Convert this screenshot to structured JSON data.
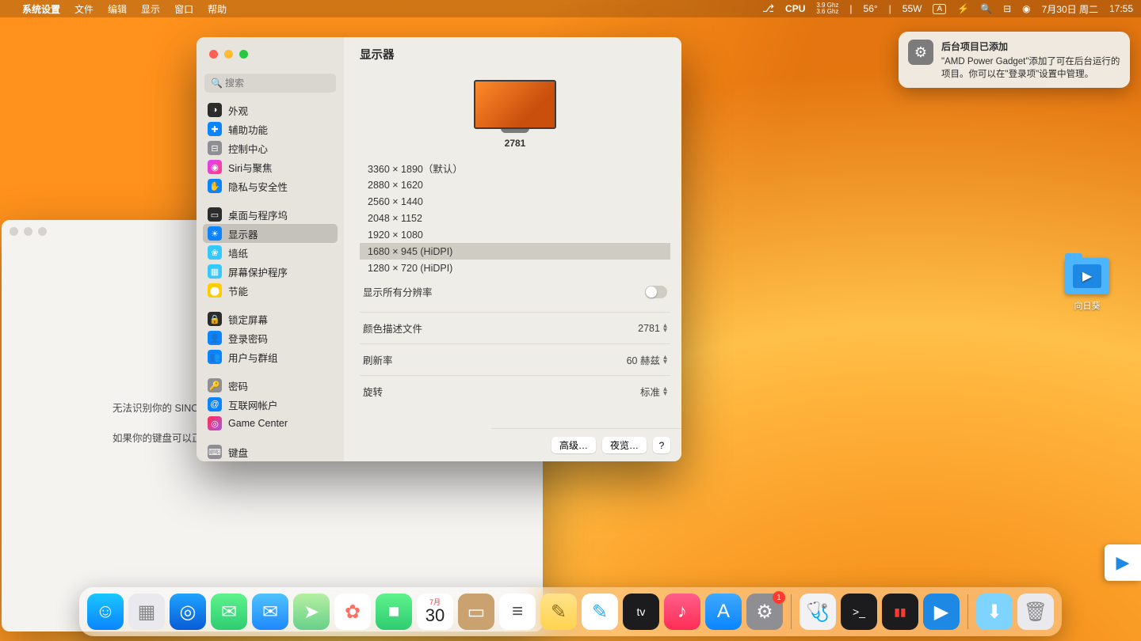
{
  "menubar": {
    "app": "系统设置",
    "items": [
      "文件",
      "编辑",
      "显示",
      "窗口",
      "帮助"
    ],
    "cpu_label": "CPU",
    "cpu_freq1": "3.9 Ghz",
    "cpu_freq2": "3.6 Ghz",
    "temp": "56°",
    "power": "55W",
    "input_indicator": "A",
    "date": "7月30日 周二",
    "time": "17:55"
  },
  "bgwin": {
    "line1": "无法识别你的 SINO",
    "line2": "如果你的键盘可以正常使用，则可以退出此助手。"
  },
  "win": {
    "title": "显示器",
    "search_placeholder": "搜索",
    "monitor_name": "2781",
    "resolutions": [
      {
        "label": "3360 × 1890（默认）",
        "sel": false
      },
      {
        "label": "2880 × 1620",
        "sel": false
      },
      {
        "label": "2560 × 1440",
        "sel": false
      },
      {
        "label": "2048 × 1152",
        "sel": false
      },
      {
        "label": "1920 × 1080",
        "sel": false
      },
      {
        "label": "1680 × 945 (HiDPI)",
        "sel": true
      },
      {
        "label": "1280 × 720 (HiDPI)",
        "sel": false
      }
    ],
    "show_all_label": "显示所有分辨率",
    "rows": {
      "color_profile_label": "颜色描述文件",
      "color_profile_value": "2781",
      "refresh_label": "刷新率",
      "refresh_value": "60 赫兹",
      "rotation_label": "旋转",
      "rotation_value": "标准"
    },
    "buttons": {
      "advanced": "高级…",
      "night": "夜览…",
      "help": "?"
    }
  },
  "sidebar": [
    {
      "label": "外观",
      "ic": "◑",
      "bg": "#2c2c2c"
    },
    {
      "label": "辅助功能",
      "ic": "✚",
      "bg": "#0a84ff"
    },
    {
      "label": "控制中心",
      "ic": "⊟",
      "bg": "#8e8e93"
    },
    {
      "label": "Siri与聚焦",
      "ic": "◉",
      "bg": "linear-gradient(135deg,#e040fb,#ff4081)"
    },
    {
      "label": "隐私与安全性",
      "ic": "✋",
      "bg": "#0a84ff"
    },
    {
      "gap": true
    },
    {
      "label": "桌面与程序坞",
      "ic": "▭",
      "bg": "#2c2c2c"
    },
    {
      "label": "显示器",
      "ic": "☀",
      "bg": "#0a84ff",
      "sel": true
    },
    {
      "label": "墙纸",
      "ic": "❀",
      "bg": "#34c8ff"
    },
    {
      "label": "屏幕保护程序",
      "ic": "▦",
      "bg": "#34c8ff"
    },
    {
      "label": "节能",
      "ic": "⬤",
      "bg": "#ffcc00"
    },
    {
      "gap": true
    },
    {
      "label": "锁定屏幕",
      "ic": "🔒",
      "bg": "#2c2c2c"
    },
    {
      "label": "登录密码",
      "ic": "👤",
      "bg": "#0a84ff"
    },
    {
      "label": "用户与群组",
      "ic": "👥",
      "bg": "#0a84ff"
    },
    {
      "gap": true
    },
    {
      "label": "密码",
      "ic": "🔑",
      "bg": "#8e8e93"
    },
    {
      "label": "互联网帐户",
      "ic": "@",
      "bg": "#0a84ff"
    },
    {
      "label": "Game Center",
      "ic": "◎",
      "bg": "linear-gradient(135deg,#ff2d55,#af52de)"
    },
    {
      "gap": true
    },
    {
      "label": "键盘",
      "ic": "⌨",
      "bg": "#8e8e93"
    }
  ],
  "notif": {
    "title": "后台项目已添加",
    "body": "\"AMD Power Gadget\"添加了可在后台运行的项目。你可以在\"登录项\"设置中管理。"
  },
  "desktop_icon": {
    "label": "向日葵"
  },
  "dock": {
    "cal_month": "7月",
    "cal_day": "30",
    "badge_settings": "1",
    "items_left": [
      {
        "name": "finder",
        "bg": "linear-gradient(#1ac7ff,#0a84ff)",
        "glyph": "☺"
      },
      {
        "name": "launchpad",
        "bg": "#e9e9ee",
        "glyph": "▦",
        "color": "#888"
      },
      {
        "name": "safari",
        "bg": "linear-gradient(#1fa4ff,#0a5bd6)",
        "glyph": "◎"
      },
      {
        "name": "messages",
        "bg": "linear-gradient(#5ef38c,#2ecc71)",
        "glyph": "✉"
      },
      {
        "name": "mail",
        "bg": "linear-gradient(#4fc3ff,#1e88ff)",
        "glyph": "✉"
      },
      {
        "name": "maps",
        "bg": "linear-gradient(#b7f0a2,#67d08a)",
        "glyph": "➤"
      },
      {
        "name": "photos",
        "bg": "#fff",
        "glyph": "✿",
        "color": "#ff6f61"
      },
      {
        "name": "facetime",
        "bg": "linear-gradient(#5ef38c,#2ecc71)",
        "glyph": "■"
      },
      {
        "name": "calendar",
        "cal": true
      },
      {
        "name": "contacts",
        "bg": "#c9a270",
        "glyph": "▭"
      },
      {
        "name": "reminders",
        "bg": "#fff",
        "glyph": "≡",
        "color": "#555"
      },
      {
        "name": "notes",
        "bg": "linear-gradient(#ffe28a,#ffd34f)",
        "glyph": "✎",
        "color": "#8a6d1f"
      },
      {
        "name": "freeform",
        "bg": "#fff",
        "glyph": "✎",
        "color": "#2aa8ff"
      },
      {
        "name": "appletv",
        "bg": "#1c1c1e",
        "glyph": "tv",
        "fs": "14"
      },
      {
        "name": "music",
        "bg": "linear-gradient(#ff5e8a,#ff2d55)",
        "glyph": "♪"
      },
      {
        "name": "appstore",
        "bg": "linear-gradient(#3fa9ff,#0a84ff)",
        "glyph": "A"
      },
      {
        "name": "settings",
        "bg": "#8e8e93",
        "glyph": "⚙",
        "badge": "1"
      }
    ],
    "items_right": [
      {
        "name": "diagnostics",
        "bg": "#f2f2f5",
        "glyph": "🩺",
        "color": "#555"
      },
      {
        "name": "terminal",
        "bg": "#1c1c1e",
        "glyph": ">_",
        "fs": "14"
      },
      {
        "name": "activity",
        "bg": "#1c1c1e",
        "glyph": "▮▮",
        "fs": "14",
        "color": "#ff3b30"
      },
      {
        "name": "sunflower",
        "bg": "#1e88e5",
        "glyph": "▶"
      }
    ],
    "items_end": [
      {
        "name": "downloads",
        "bg": "#7fd3ff",
        "glyph": "⬇"
      },
      {
        "name": "trash",
        "bg": "#e9e9ee",
        "glyph": "🗑",
        "color": "#888"
      }
    ]
  }
}
